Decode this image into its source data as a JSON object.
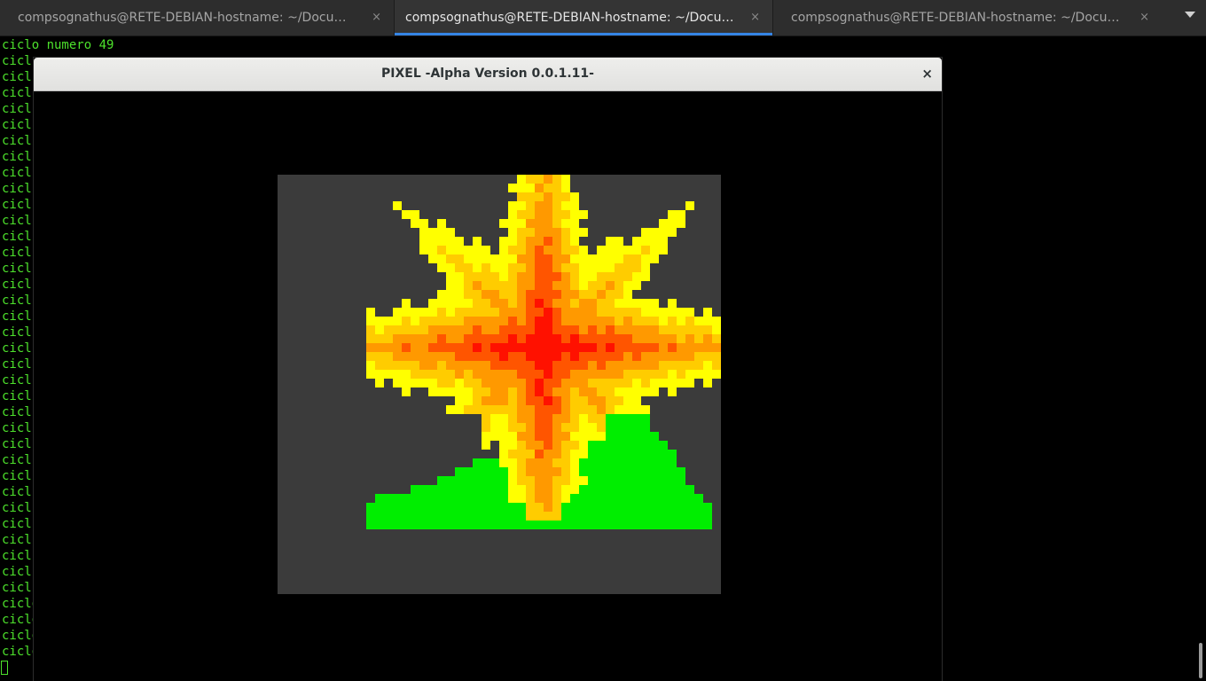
{
  "tabs": [
    {
      "title": "compsognathus@RETE-DEBIAN-hostname: ~/Documenti",
      "active": false
    },
    {
      "title": "compsognathus@RETE-DEBIAN-hostname: ~/Documenti",
      "active": true
    },
    {
      "title": "compsognathus@RETE-DEBIAN-hostname: ~/Documenti",
      "active": false
    }
  ],
  "close_glyph": "×",
  "terminal": {
    "line_full": "ciclo numero 49",
    "line_partial": "cicl",
    "prompt": ""
  },
  "window": {
    "title": "PIXEL -Alpha Version 0.0.1.11-",
    "close": "×"
  },
  "colors": {
    "terminal_text": "#4de12c",
    "canvas_bg": "#3b3b3b",
    "grass": "#00ee00",
    "flame_yellow": "#ffff00",
    "flame_orange": "#ff9900",
    "flame_red": "#ff1100",
    "tab_accent": "#3584e4"
  }
}
